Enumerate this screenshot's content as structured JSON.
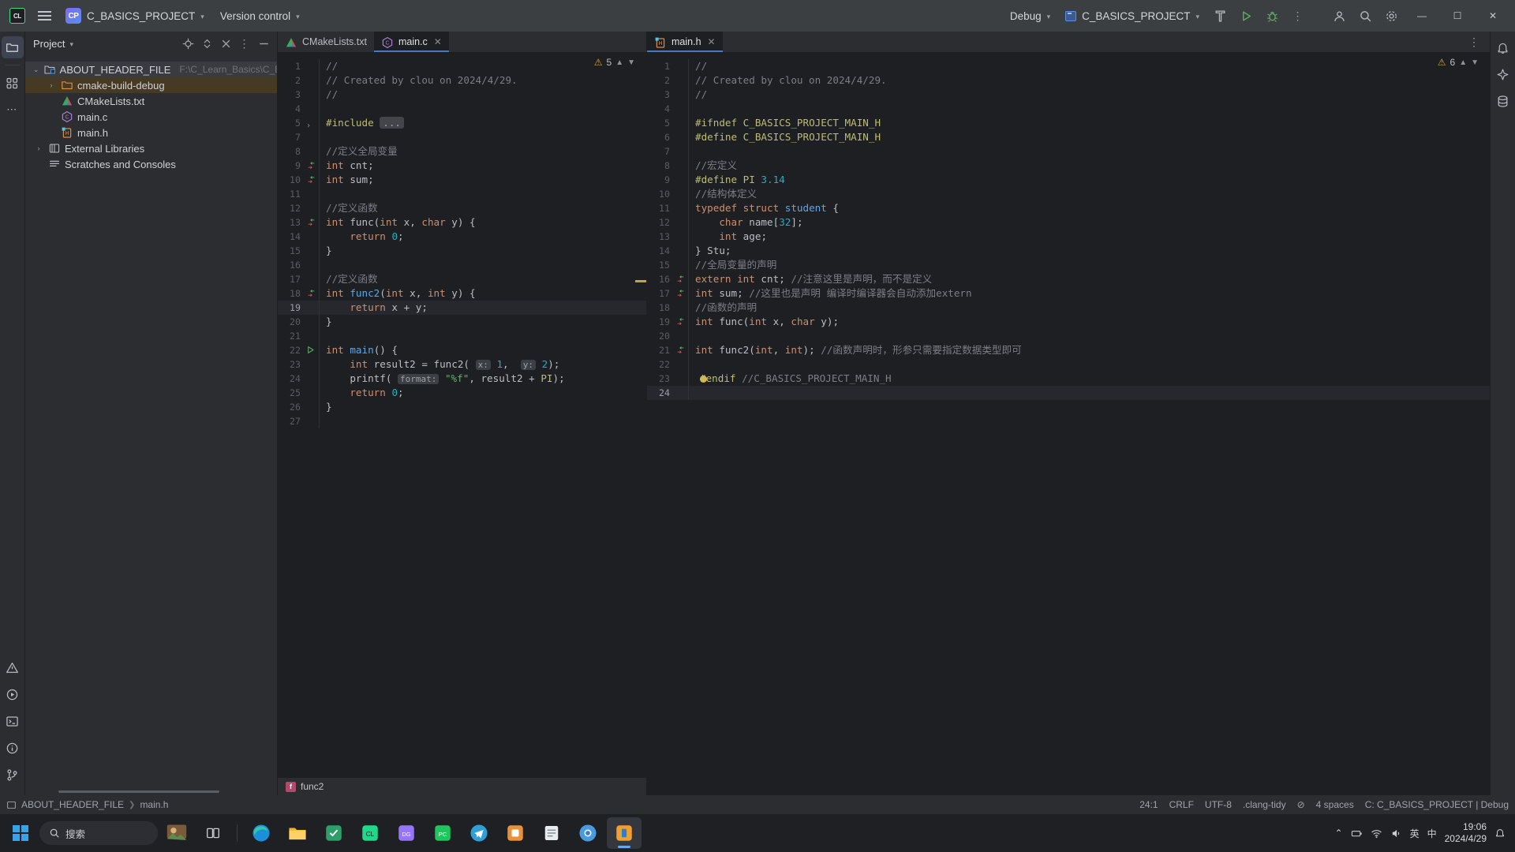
{
  "titlebar": {
    "logo_label": "CL",
    "project_badge": "CP",
    "project_name": "C_BASICS_PROJECT",
    "vcs_label": "Version control",
    "run_config_profile": "Debug",
    "run_config_name": "C_BASICS_PROJECT",
    "icons": {
      "menu": "hamburger-icon",
      "build": "build-hammer-icon",
      "run": "run-icon",
      "debug": "debug-icon",
      "more": "more-vertical-icon",
      "account": "account-icon",
      "search": "search-icon",
      "settings": "settings-icon"
    },
    "window_controls": {
      "minimize": "—",
      "maximize": "☐",
      "close": "✕"
    }
  },
  "rail": {
    "items": [
      {
        "name": "project-tool-window",
        "icon": "folder-icon",
        "active": true
      },
      {
        "name": "structure-tool-window",
        "icon": "structure-icon",
        "active": false
      },
      {
        "name": "more-tool-windows",
        "icon": "more-horizontal-icon",
        "active": false
      }
    ],
    "bottom_items": [
      {
        "name": "problems-tool-window",
        "icon": "warning-triangle-icon"
      },
      {
        "name": "run-tool-window",
        "icon": "run-circle-icon"
      },
      {
        "name": "terminal-tool-window",
        "icon": "terminal-icon"
      },
      {
        "name": "notifications-tool-window",
        "icon": "info-circle-icon"
      },
      {
        "name": "version-control-tool-window",
        "icon": "branch-icon"
      }
    ],
    "right_items": [
      {
        "name": "notifications",
        "icon": "bell-icon"
      },
      {
        "name": "ai-assistant",
        "icon": "ai-icon"
      },
      {
        "name": "database",
        "icon": "database-icon"
      }
    ]
  },
  "project_panel": {
    "title": "Project",
    "actions": [
      "select-opened-file-icon",
      "expand-collapse-icon",
      "close-icon",
      "options-icon",
      "hide-icon"
    ],
    "tree": [
      {
        "indent": 0,
        "twisty": "⌄",
        "icon": "project-root-icon",
        "label": "ABOUT_HEADER_FILE",
        "path": "F:\\C_Learn_Basics\\C_BASICS_P",
        "state": "root-selected"
      },
      {
        "indent": 1,
        "twisty": "›",
        "icon": "folder-excluded-icon",
        "label": "cmake-build-debug",
        "path": "",
        "state": "highlighted"
      },
      {
        "indent": 1,
        "twisty": "",
        "icon": "cmake-file-icon",
        "label": "CMakeLists.txt",
        "path": "",
        "state": ""
      },
      {
        "indent": 1,
        "twisty": "",
        "icon": "c-file-icon",
        "label": "main.c",
        "path": "",
        "state": ""
      },
      {
        "indent": 1,
        "twisty": "",
        "icon": "h-file-icon",
        "label": "main.h",
        "path": "",
        "state": ""
      },
      {
        "indent": 0,
        "twisty": "›",
        "icon": "library-icon",
        "label": "External Libraries",
        "path": "",
        "state": ""
      },
      {
        "indent": 0,
        "twisty": "",
        "icon": "scratches-icon",
        "label": "Scratches and Consoles",
        "path": "",
        "state": ""
      }
    ]
  },
  "editor_left": {
    "tabs": [
      {
        "label": "CMakeLists.txt",
        "icon": "cmake-file-icon",
        "active": false,
        "closable": false
      },
      {
        "label": "main.c",
        "icon": "c-file-icon",
        "active": true,
        "closable": true
      }
    ],
    "inspection": {
      "count": "5",
      "icon": "warning-triangle-icon"
    },
    "breadcrumb": {
      "icon": "function-icon",
      "label": "func2"
    },
    "lines": [
      {
        "n": "1",
        "mark": "",
        "tokens": [
          {
            "t": "//",
            "c": "cmt"
          }
        ]
      },
      {
        "n": "2",
        "mark": "",
        "tokens": [
          {
            "t": "// Created by clou on 2024/4/29.",
            "c": "cmt"
          }
        ]
      },
      {
        "n": "3",
        "mark": "",
        "tokens": [
          {
            "t": "//",
            "c": "cmt"
          }
        ]
      },
      {
        "n": "4",
        "mark": "",
        "tokens": []
      },
      {
        "n": "5",
        "mark": "fold",
        "tokens": [
          {
            "t": "#include ",
            "c": "pre"
          },
          {
            "t": "...",
            "c": "fold"
          }
        ]
      },
      {
        "n": "7",
        "mark": "",
        "tokens": []
      },
      {
        "n": "8",
        "mark": "",
        "tokens": [
          {
            "t": "//定义全局变量",
            "c": "cmt"
          }
        ]
      },
      {
        "n": "9",
        "mark": "override",
        "tokens": [
          {
            "t": "int",
            "c": "kw"
          },
          {
            "t": " cnt",
            "c": "var"
          },
          {
            "t": ";",
            "c": "pl"
          }
        ]
      },
      {
        "n": "10",
        "mark": "override",
        "tokens": [
          {
            "t": "int",
            "c": "kw"
          },
          {
            "t": " sum",
            "c": "var"
          },
          {
            "t": ";",
            "c": "pl"
          }
        ]
      },
      {
        "n": "11",
        "mark": "",
        "tokens": []
      },
      {
        "n": "12",
        "mark": "",
        "tokens": [
          {
            "t": "//定义函数",
            "c": "cmt"
          }
        ]
      },
      {
        "n": "13",
        "mark": "override",
        "tokens": [
          {
            "t": "int",
            "c": "kw"
          },
          {
            "t": " func",
            "c": "var"
          },
          {
            "t": "(",
            "c": "pl"
          },
          {
            "t": "int",
            "c": "kw"
          },
          {
            "t": " x",
            "c": "var"
          },
          {
            "t": ", ",
            "c": "pl"
          },
          {
            "t": "char",
            "c": "kw"
          },
          {
            "t": " y",
            "c": "var"
          },
          {
            "t": ") {",
            "c": "pl"
          }
        ]
      },
      {
        "n": "14",
        "mark": "",
        "tokens": [
          {
            "t": "    ",
            "c": "pl"
          },
          {
            "t": "return",
            "c": "kw"
          },
          {
            "t": " ",
            "c": "pl"
          },
          {
            "t": "0",
            "c": "num"
          },
          {
            "t": ";",
            "c": "pl"
          }
        ]
      },
      {
        "n": "15",
        "mark": "",
        "tokens": [
          {
            "t": "}",
            "c": "pl"
          }
        ]
      },
      {
        "n": "16",
        "mark": "",
        "tokens": []
      },
      {
        "n": "17",
        "mark": "",
        "tokens": [
          {
            "t": "//定义函数",
            "c": "cmt"
          }
        ]
      },
      {
        "n": "18",
        "mark": "override",
        "tokens": [
          {
            "t": "int",
            "c": "kw"
          },
          {
            "t": " func2",
            "c": "fn"
          },
          {
            "t": "(",
            "c": "pl"
          },
          {
            "t": "int",
            "c": "kw"
          },
          {
            "t": " x",
            "c": "var"
          },
          {
            "t": ", ",
            "c": "pl"
          },
          {
            "t": "int",
            "c": "kw"
          },
          {
            "t": " y",
            "c": "var"
          },
          {
            "t": ") {",
            "c": "pl"
          }
        ]
      },
      {
        "n": "19",
        "mark": "",
        "current": true,
        "tokens": [
          {
            "t": "    ",
            "c": "pl"
          },
          {
            "t": "return",
            "c": "kw"
          },
          {
            "t": " x + y;",
            "c": "pl"
          }
        ]
      },
      {
        "n": "20",
        "mark": "",
        "tokens": [
          {
            "t": "}",
            "c": "pl"
          }
        ]
      },
      {
        "n": "21",
        "mark": "",
        "tokens": []
      },
      {
        "n": "22",
        "mark": "run",
        "tokens": [
          {
            "t": "int",
            "c": "kw"
          },
          {
            "t": " ",
            "c": "pl"
          },
          {
            "t": "main",
            "c": "fn"
          },
          {
            "t": "() {",
            "c": "pl"
          }
        ]
      },
      {
        "n": "23",
        "mark": "",
        "tokens": [
          {
            "t": "    ",
            "c": "pl"
          },
          {
            "t": "int",
            "c": "kw"
          },
          {
            "t": " result2 = ",
            "c": "pl"
          },
          {
            "t": "func2",
            "c": "var"
          },
          {
            "t": "( ",
            "c": "pl"
          },
          {
            "t": "x:",
            "c": "inlay"
          },
          {
            "t": " ",
            "c": "pl"
          },
          {
            "t": "1",
            "c": "num"
          },
          {
            "t": ",  ",
            "c": "pl"
          },
          {
            "t": "y:",
            "c": "inlay"
          },
          {
            "t": " ",
            "c": "pl"
          },
          {
            "t": "2",
            "c": "num"
          },
          {
            "t": ");",
            "c": "pl"
          }
        ]
      },
      {
        "n": "24",
        "mark": "",
        "tokens": [
          {
            "t": "    ",
            "c": "pl"
          },
          {
            "t": "printf",
            "c": "var"
          },
          {
            "t": "( ",
            "c": "pl"
          },
          {
            "t": "format:",
            "c": "inlay"
          },
          {
            "t": " ",
            "c": "pl"
          },
          {
            "t": "\"%f\"",
            "c": "str"
          },
          {
            "t": ", result2 + ",
            "c": "pl"
          },
          {
            "t": "PI",
            "c": "pre"
          },
          {
            "t": ");",
            "c": "pl"
          }
        ]
      },
      {
        "n": "25",
        "mark": "",
        "tokens": [
          {
            "t": "    ",
            "c": "pl"
          },
          {
            "t": "return",
            "c": "kw"
          },
          {
            "t": " ",
            "c": "pl"
          },
          {
            "t": "0",
            "c": "num"
          },
          {
            "t": ";",
            "c": "pl"
          }
        ]
      },
      {
        "n": "26",
        "mark": "",
        "tokens": [
          {
            "t": "}",
            "c": "pl"
          }
        ]
      },
      {
        "n": "27",
        "mark": "",
        "tokens": []
      }
    ]
  },
  "editor_right": {
    "tabs": [
      {
        "label": "main.h",
        "icon": "h-file-icon",
        "active": true,
        "closable": true
      }
    ],
    "inspection": {
      "count": "6",
      "icon": "warning-triangle-icon"
    },
    "lines": [
      {
        "n": "1",
        "mark": "",
        "tokens": [
          {
            "t": "//",
            "c": "cmt"
          }
        ]
      },
      {
        "n": "2",
        "mark": "",
        "tokens": [
          {
            "t": "// Created by clou on 2024/4/29.",
            "c": "cmt"
          }
        ]
      },
      {
        "n": "3",
        "mark": "",
        "tokens": [
          {
            "t": "//",
            "c": "cmt"
          }
        ]
      },
      {
        "n": "4",
        "mark": "",
        "tokens": []
      },
      {
        "n": "5",
        "mark": "",
        "tokens": [
          {
            "t": "#ifndef",
            "c": "pre"
          },
          {
            "t": " C_BASICS_PROJECT_MAIN_H",
            "c": "pre"
          }
        ]
      },
      {
        "n": "6",
        "mark": "",
        "tokens": [
          {
            "t": "#define",
            "c": "pre"
          },
          {
            "t": " C_BASICS_PROJECT_MAIN_H",
            "c": "pre"
          }
        ]
      },
      {
        "n": "7",
        "mark": "",
        "tokens": []
      },
      {
        "n": "8",
        "mark": "",
        "tokens": [
          {
            "t": "//宏定义",
            "c": "cmt"
          }
        ]
      },
      {
        "n": "9",
        "mark": "",
        "tokens": [
          {
            "t": "#define",
            "c": "pre"
          },
          {
            "t": " PI ",
            "c": "pre"
          },
          {
            "t": "3.14",
            "c": "num"
          }
        ]
      },
      {
        "n": "10",
        "mark": "",
        "tokens": [
          {
            "t": "//结构体定义",
            "c": "cmt"
          }
        ]
      },
      {
        "n": "11",
        "mark": "",
        "tokens": [
          {
            "t": "typedef",
            "c": "kw"
          },
          {
            "t": " ",
            "c": "pl"
          },
          {
            "t": "struct",
            "c": "kw"
          },
          {
            "t": " ",
            "c": "pl"
          },
          {
            "t": "student",
            "c": "fn"
          },
          {
            "t": " {",
            "c": "pl"
          }
        ]
      },
      {
        "n": "12",
        "mark": "",
        "tokens": [
          {
            "t": "    ",
            "c": "pl"
          },
          {
            "t": "char",
            "c": "kw"
          },
          {
            "t": " name",
            "c": "var"
          },
          {
            "t": "[",
            "c": "pl"
          },
          {
            "t": "32",
            "c": "num"
          },
          {
            "t": "];",
            "c": "pl"
          }
        ]
      },
      {
        "n": "13",
        "mark": "",
        "tokens": [
          {
            "t": "    ",
            "c": "pl"
          },
          {
            "t": "int",
            "c": "kw"
          },
          {
            "t": " age",
            "c": "var"
          },
          {
            "t": ";",
            "c": "pl"
          }
        ]
      },
      {
        "n": "14",
        "mark": "",
        "tokens": [
          {
            "t": "} Stu;",
            "c": "pl"
          }
        ]
      },
      {
        "n": "15",
        "mark": "",
        "tokens": [
          {
            "t": "//全局变量的声明",
            "c": "cmt"
          }
        ]
      },
      {
        "n": "16",
        "mark": "override",
        "tokens": [
          {
            "t": "extern",
            "c": "kw"
          },
          {
            "t": " ",
            "c": "pl"
          },
          {
            "t": "int",
            "c": "kw"
          },
          {
            "t": " cnt",
            "c": "var"
          },
          {
            "t": "; ",
            "c": "pl"
          },
          {
            "t": "//注意这里是声明，而不是定义",
            "c": "cmt"
          }
        ]
      },
      {
        "n": "17",
        "mark": "override",
        "tokens": [
          {
            "t": "int",
            "c": "kw"
          },
          {
            "t": " sum",
            "c": "var"
          },
          {
            "t": "; ",
            "c": "pl"
          },
          {
            "t": "//这里也是声明 编译时编译器会自动添加extern",
            "c": "cmt"
          }
        ]
      },
      {
        "n": "18",
        "mark": "",
        "tokens": [
          {
            "t": "//函数的声明",
            "c": "cmt"
          }
        ]
      },
      {
        "n": "19",
        "mark": "override",
        "tokens": [
          {
            "t": "int",
            "c": "kw"
          },
          {
            "t": " func",
            "c": "var"
          },
          {
            "t": "(",
            "c": "pl"
          },
          {
            "t": "int",
            "c": "kw"
          },
          {
            "t": " x",
            "c": "var"
          },
          {
            "t": ", ",
            "c": "pl"
          },
          {
            "t": "char",
            "c": "kw"
          },
          {
            "t": " y",
            "c": "var"
          },
          {
            "t": ");",
            "c": "pl"
          }
        ]
      },
      {
        "n": "20",
        "mark": "",
        "tokens": []
      },
      {
        "n": "21",
        "mark": "override",
        "tokens": [
          {
            "t": "int",
            "c": "kw"
          },
          {
            "t": " func2",
            "c": "var"
          },
          {
            "t": "(",
            "c": "pl"
          },
          {
            "t": "int",
            "c": "kw"
          },
          {
            "t": ", ",
            "c": "pl"
          },
          {
            "t": "int",
            "c": "kw"
          },
          {
            "t": "); ",
            "c": "pl"
          },
          {
            "t": "//函数声明时，形参只需要指定数据类型即可",
            "c": "cmt"
          }
        ]
      },
      {
        "n": "22",
        "mark": "",
        "tokens": []
      },
      {
        "n": "23",
        "mark": "",
        "bulb": true,
        "tokens": [
          {
            "t": "#endif",
            "c": "pre"
          },
          {
            "t": " //C_BASICS_PROJECT_MAIN_H",
            "c": "cmt"
          }
        ]
      },
      {
        "n": "24",
        "mark": "",
        "current": true,
        "tokens": []
      }
    ]
  },
  "statusbar": {
    "breadcrumb": [
      {
        "icon": "module-icon",
        "label": "ABOUT_HEADER_FILE"
      },
      {
        "icon": "",
        "label": "main.h"
      }
    ],
    "right": [
      {
        "name": "caret-position",
        "label": "24:1"
      },
      {
        "name": "line-separator",
        "label": "CRLF"
      },
      {
        "name": "file-encoding",
        "label": "UTF-8"
      },
      {
        "name": "clang-tidy",
        "label": ".clang-tidy"
      },
      {
        "name": "inspections-widget",
        "label": "⊘"
      },
      {
        "name": "indent-setting",
        "label": "4 spaces"
      },
      {
        "name": "build-profile",
        "label": "C: C_BASICS_PROJECT | Debug"
      }
    ]
  },
  "taskbar": {
    "search_placeholder": "搜索",
    "apps": [
      {
        "name": "task-view-icon"
      },
      {
        "name": "edge-browser-icon"
      },
      {
        "name": "file-explorer-icon"
      },
      {
        "name": "app-green-icon"
      },
      {
        "name": "clion-icon"
      },
      {
        "name": "datagrip-icon"
      },
      {
        "name": "pycharm-icon"
      },
      {
        "name": "telegram-icon"
      },
      {
        "name": "app-orange-icon"
      },
      {
        "name": "notes-icon"
      },
      {
        "name": "chrome-icon"
      },
      {
        "name": "clion-active-icon"
      }
    ],
    "tray": {
      "ime_lang": "英",
      "ime_mode": "中",
      "time": "19:06",
      "date": "2024/4/29"
    }
  }
}
